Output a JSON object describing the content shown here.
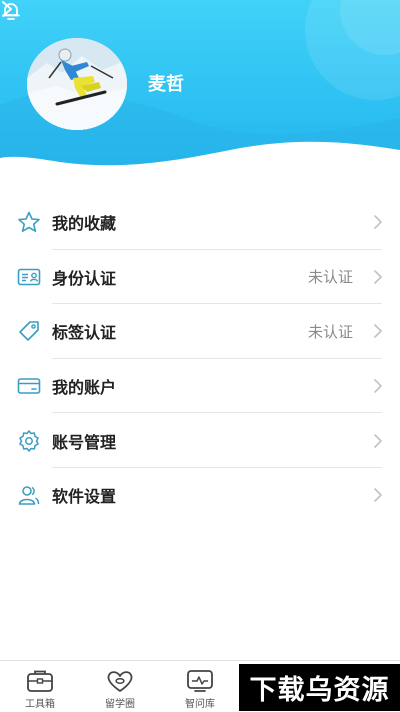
{
  "profile": {
    "name": "麦哲"
  },
  "colors": {
    "accent": "#2ec2f0",
    "header_top": "#3fd0f7",
    "header_bottom": "#22b8ee",
    "icon": "#3a9ec4"
  },
  "menu": {
    "items": [
      {
        "label": "我的收藏",
        "status": "",
        "icon": "star-icon"
      },
      {
        "label": "身份认证",
        "status": "未认证",
        "icon": "id-card-icon"
      },
      {
        "label": "标签认证",
        "status": "未认证",
        "icon": "tag-icon"
      },
      {
        "label": "我的账户",
        "status": "",
        "icon": "wallet-card-icon"
      },
      {
        "label": "账号管理",
        "status": "",
        "icon": "gear-icon"
      },
      {
        "label": "软件设置",
        "status": "",
        "icon": "users-icon"
      }
    ]
  },
  "tabbar": {
    "tabs": [
      {
        "label": "工具箱",
        "icon": "toolbox-icon"
      },
      {
        "label": "留学圈",
        "icon": "heart-icon"
      },
      {
        "label": "智问库",
        "icon": "monitor-icon"
      }
    ]
  },
  "watermark": {
    "text": "下载乌资源"
  }
}
